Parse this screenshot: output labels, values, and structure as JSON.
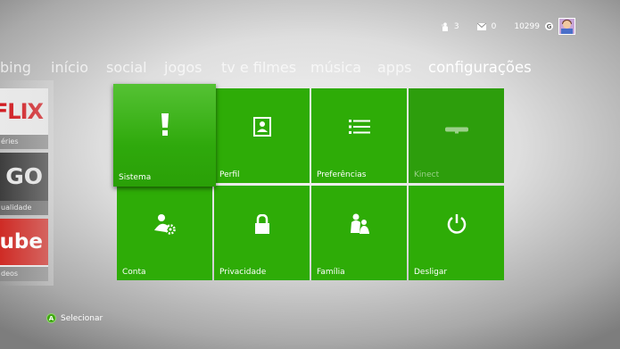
{
  "status": {
    "friends_count": "3",
    "messages_count": "0",
    "gamerscore": "10299"
  },
  "nav": {
    "items": [
      "bing",
      "início",
      "social",
      "jogos",
      "tv e filmes",
      "música",
      "apps",
      "configurações"
    ],
    "active": "configurações"
  },
  "side_tiles": [
    {
      "logo": "FLIX",
      "caption": "éries"
    },
    {
      "logo": "GO",
      "caption": "ualidade"
    },
    {
      "logo": "ube",
      "caption": "deos"
    }
  ],
  "tiles": [
    {
      "label": "Sistema",
      "icon": "system-icon",
      "focused": true
    },
    {
      "label": "Perfil",
      "icon": "profile-icon"
    },
    {
      "label": "Preferências",
      "icon": "list-icon"
    },
    {
      "label": "Kinect",
      "icon": "kinect-icon",
      "disabled": true
    },
    {
      "label": "Conta",
      "icon": "account-gear-icon"
    },
    {
      "label": "Privacidade",
      "icon": "lock-icon"
    },
    {
      "label": "Família",
      "icon": "family-icon"
    },
    {
      "label": "Desligar",
      "icon": "power-icon"
    }
  ],
  "footer": {
    "button": "A",
    "action": "Selecionar"
  },
  "colors": {
    "tile_green": "#2eac07",
    "focused_green": "#55c234"
  }
}
